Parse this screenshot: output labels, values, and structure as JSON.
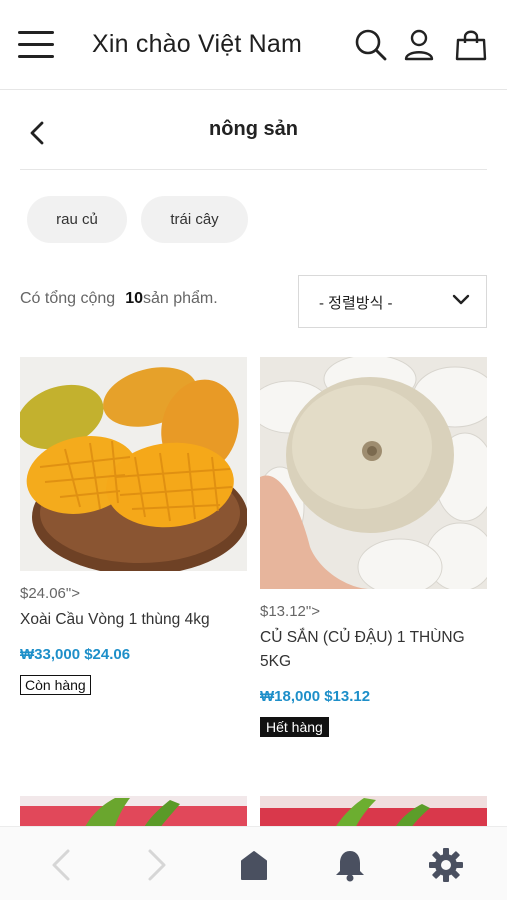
{
  "header": {
    "title": "Xin chào Việt Nam",
    "icons": [
      "menu-icon",
      "search-icon",
      "user-icon",
      "shopping-bag-icon"
    ]
  },
  "category": {
    "title": "nông sản",
    "back_icon": "chevron-left-icon"
  },
  "chips": [
    {
      "label": "rau củ"
    },
    {
      "label": "trái cây"
    }
  ],
  "listing": {
    "count_prefix": "Có tổng cộng",
    "count_value": "10",
    "count_suffix": "sản phẩm.",
    "sort_label": "- 정렬방식 -"
  },
  "products": [
    {
      "old_price": "$24.06\">",
      "name": "Xoài Cầu Vòng 1 thùng 4kg",
      "price": "₩33,000 $24.06",
      "status": "Còn hàng"
    },
    {
      "old_price": "$13.12\">",
      "name": "CỦ SẮN (CỦ ĐẬU) 1 THÙNG 5KG",
      "price": "₩18,000 $13.12",
      "status": "Hết hàng"
    }
  ],
  "colors": {
    "price": "#1e8fc9",
    "chip_bg": "#f1f1f1",
    "nav_icon_active": "#4a5060",
    "nav_icon_inactive": "#d6d6d6"
  },
  "bottom_nav": [
    "back-arrow-icon",
    "forward-arrow-icon",
    "home-icon",
    "bell-icon",
    "gear-icon"
  ]
}
